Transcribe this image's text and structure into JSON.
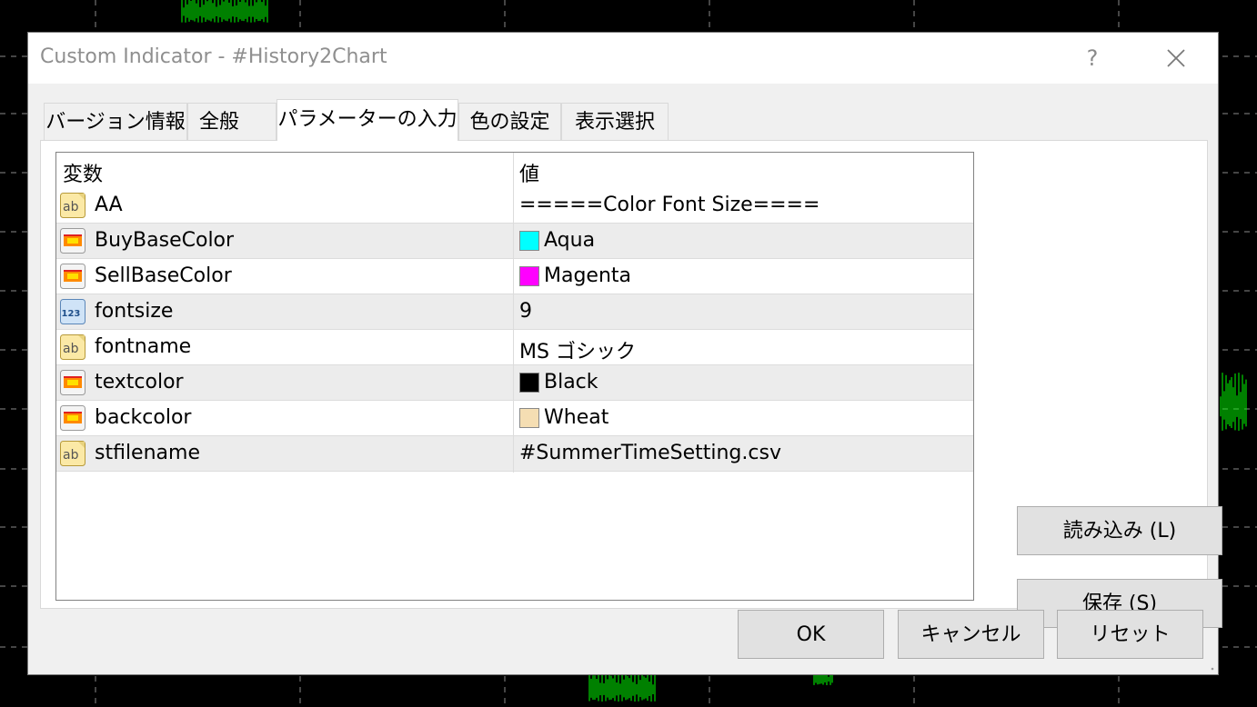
{
  "window": {
    "title": "Custom Indicator - #History2Chart",
    "help_label": "?"
  },
  "tabs": [
    {
      "label": "バージョン情報"
    },
    {
      "label": "全般"
    },
    {
      "label": "パラメーターの入力"
    },
    {
      "label": "色の設定"
    },
    {
      "label": "表示選択"
    }
  ],
  "active_tab": "パラメーターの入力",
  "grid": {
    "headers": {
      "variable": "変数",
      "value": "値"
    },
    "rows": [
      {
        "icon": "string-icon",
        "name": "AA",
        "value": "=====Color Font Size===="
      },
      {
        "icon": "color-icon",
        "name": "BuyBaseColor",
        "value": "Aqua",
        "swatch": "#00ffff"
      },
      {
        "icon": "color-icon",
        "name": "SellBaseColor",
        "value": "Magenta",
        "swatch": "#ff00ff"
      },
      {
        "icon": "integer-icon",
        "name": "fontsize",
        "value": "9"
      },
      {
        "icon": "string-icon",
        "name": "fontname",
        "value": "MS ゴシック"
      },
      {
        "icon": "color-icon",
        "name": "textcolor",
        "value": "Black",
        "swatch": "#000000"
      },
      {
        "icon": "color-icon",
        "name": "backcolor",
        "value": "Wheat",
        "swatch": "#f5deb3"
      },
      {
        "icon": "string-icon",
        "name": "stfilename",
        "value": "#SummerTimeSetting.csv"
      }
    ]
  },
  "side_buttons": {
    "load_label": "読み込み (L)",
    "save_label": "保存 (S)"
  },
  "footer_buttons": {
    "ok_label": "OK",
    "cancel_label": "キャンセル",
    "reset_label": "リセット"
  },
  "colors": {
    "chart_background": "#000000",
    "chart_candle": "#00ff00",
    "dialog_background": "#f0f0f0",
    "alt_row": "#ececec"
  }
}
